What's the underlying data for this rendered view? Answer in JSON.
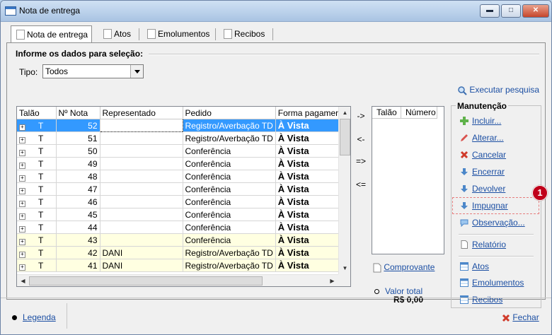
{
  "window": {
    "title": "Nota de entrega"
  },
  "tabs": [
    "Nota de entrega",
    "Atos",
    "Emolumentos",
    "Recibos"
  ],
  "section_title": "Informe os dados para seleção:",
  "tipo": {
    "label": "Tipo:",
    "value": "Todos"
  },
  "execute_label": "Executar pesquisa",
  "grid": {
    "columns": [
      "Talão",
      "Nº Nota",
      "Representado",
      "Pedido",
      "Forma pagamento"
    ],
    "rows": [
      {
        "talao": "T",
        "nota": "52",
        "rep": "",
        "pedido": "Registro/Averbação TD",
        "forma": "À Vista"
      },
      {
        "talao": "T",
        "nota": "51",
        "rep": "",
        "pedido": "Registro/Averbação TD",
        "forma": "À Vista"
      },
      {
        "talao": "T",
        "nota": "50",
        "rep": "",
        "pedido": "Conferência",
        "forma": "À Vista"
      },
      {
        "talao": "T",
        "nota": "49",
        "rep": "",
        "pedido": "Conferência",
        "forma": "À Vista"
      },
      {
        "talao": "T",
        "nota": "48",
        "rep": "",
        "pedido": "Conferência",
        "forma": "À Vista"
      },
      {
        "talao": "T",
        "nota": "47",
        "rep": "",
        "pedido": "Conferência",
        "forma": "À Vista"
      },
      {
        "talao": "T",
        "nota": "46",
        "rep": "",
        "pedido": "Conferência",
        "forma": "À Vista"
      },
      {
        "talao": "T",
        "nota": "45",
        "rep": "",
        "pedido": "Conferência",
        "forma": "À Vista"
      },
      {
        "talao": "T",
        "nota": "44",
        "rep": "",
        "pedido": "Conferência",
        "forma": "À Vista"
      },
      {
        "talao": "T",
        "nota": "43",
        "rep": "",
        "pedido": "Conferência",
        "forma": "À Vista"
      },
      {
        "talao": "T",
        "nota": "42",
        "rep": "DANI",
        "pedido": "Registro/Averbação TD",
        "forma": "À Vista"
      },
      {
        "talao": "T",
        "nota": "41",
        "rep": "DANI",
        "pedido": "Registro/Averbação TD",
        "forma": "À Vista"
      }
    ]
  },
  "move_buttons": [
    "->",
    "<-",
    "=>",
    "<="
  ],
  "selected_list": {
    "columns": [
      "Talão",
      "Número"
    ]
  },
  "comprovante_label": "Comprovante",
  "valor_total": {
    "label": "Valor total",
    "value": "R$ 0,00"
  },
  "manutencao": {
    "title": "Manutenção",
    "items": [
      "Incluir...",
      "Alterar...",
      "Cancelar",
      "Encerrar",
      "Devolver",
      "Impugnar",
      "Observação...",
      "Relatório",
      "Atos",
      "Emolumentos",
      "Recibos"
    ]
  },
  "badge": "1",
  "footer": {
    "legenda": "Legenda",
    "fechar": "Fechar"
  },
  "colors": {
    "selection": "#3399ff",
    "highlight_row": "#ffffe1",
    "link": "#1c4fa3",
    "badge": "#c0001a"
  }
}
